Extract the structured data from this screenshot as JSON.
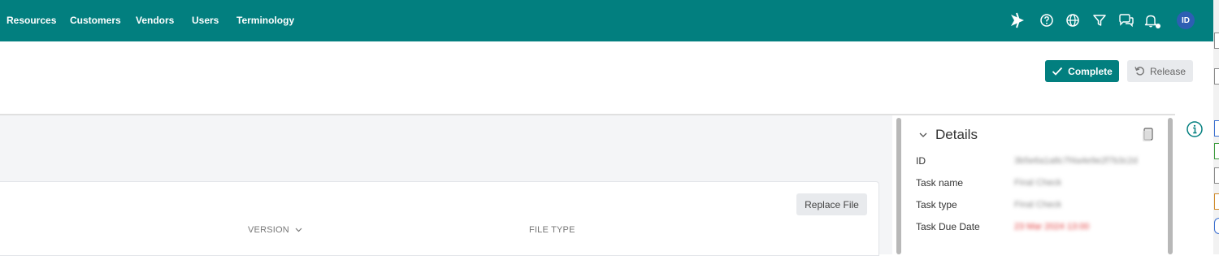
{
  "nav": {
    "items": [
      "Resources",
      "Customers",
      "Vendors",
      "Users",
      "Terminology"
    ],
    "avatar_initials": "ID",
    "icons": [
      "launch-icon",
      "help-icon",
      "globe-icon",
      "filter-icon",
      "chat-icon",
      "notification-icon"
    ]
  },
  "actions": {
    "complete_label": "Complete",
    "release_label": "Release"
  },
  "files": {
    "replace_label": "Replace File",
    "columns": [
      "VERSION",
      "FILE TYPE"
    ]
  },
  "details": {
    "title": "Details",
    "fields": [
      {
        "label": "ID",
        "value": "3b5e6a1a8c7f4a4e9e2f7b3c2d"
      },
      {
        "label": "Task name",
        "value": "Final Check"
      },
      {
        "label": "Task type",
        "value": "Final Check"
      },
      {
        "label": "Task Due Date",
        "value": "23 Mar 2024 13:00"
      }
    ]
  },
  "colors": {
    "brand": "#027f7f",
    "avatar": "#2d5fb3",
    "due_date": "#e23b3b"
  }
}
